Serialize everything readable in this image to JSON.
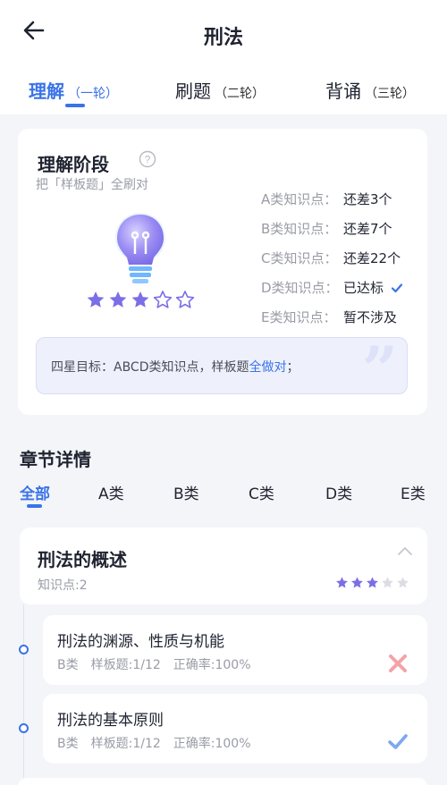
{
  "header": {
    "title": "刑法"
  },
  "tabs": [
    {
      "label": "理解",
      "sub": "（一轮）",
      "active": true
    },
    {
      "label": "刷题",
      "sub": "（二轮）",
      "active": false
    },
    {
      "label": "背诵",
      "sub": "（三轮）",
      "active": false
    }
  ],
  "stage": {
    "title": "理解阶段",
    "subtitle": "把「样板题」全刷对",
    "rating": 3,
    "max_rating": 5,
    "knowledge_points": [
      {
        "label": "A类知识点：",
        "value": "还差3个"
      },
      {
        "label": "B类知识点：",
        "value": "还差7个"
      },
      {
        "label": "C类知识点：",
        "value": "还差22个"
      },
      {
        "label": "D类知识点：",
        "value": "已达标"
      },
      {
        "label": "E类知识点：",
        "value": "暂不涉及"
      }
    ],
    "goal": {
      "prefix": "四星目标：ABCD类知识点，样板题",
      "highlight": "全做对",
      "suffix": "；"
    }
  },
  "chapters_section": {
    "title": "章节详情",
    "filters": [
      "全部",
      "A类",
      "B类",
      "C类",
      "D类",
      "E类"
    ]
  },
  "chapter": {
    "title": "刑法的概述",
    "meta": "知识点:2",
    "rating": 3,
    "max_rating": 5
  },
  "sections": [
    {
      "title": "刑法的渊源、性质与机能",
      "category": "B类",
      "sample": "样板题:1/12",
      "accuracy": "正确率:100%",
      "status": "wrong"
    },
    {
      "title": "刑法的基本原则",
      "category": "B类",
      "sample": "样板题:1/12",
      "accuracy": "正确率:100%",
      "status": "correct"
    }
  ],
  "colors": {
    "accent": "#3a73e8",
    "star": "#7b6ee6",
    "star_empty": "#dcdde3",
    "wrong": "#f4a3a6",
    "correct": "#7ea8f0"
  }
}
